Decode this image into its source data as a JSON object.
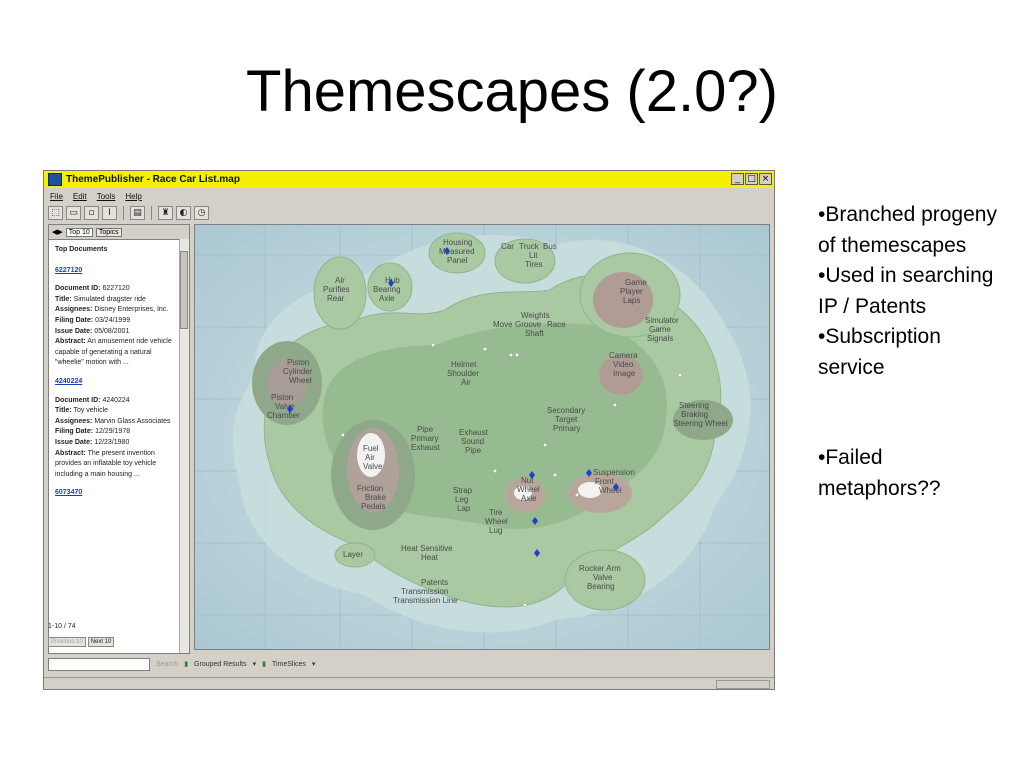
{
  "slide": {
    "title": "Themescapes (2.0?)",
    "bullets": [
      "•Branched progeny of themescapes",
      "•Used in searching IP / Patents",
      "•Subscription service",
      "•Failed metaphors??"
    ]
  },
  "window": {
    "title": "ThemePublisher - Race Car List.map",
    "controls": [
      "_",
      "□",
      "×"
    ],
    "menu": [
      "File",
      "Edit",
      "Tools",
      "Help"
    ]
  },
  "left_panel": {
    "tabs": [
      "Top 10",
      "Topics"
    ],
    "heading": "Top Documents",
    "records": [
      {
        "link": "6227120",
        "doc_id_label": "Document ID:",
        "doc_id": "6227120",
        "title_label": "Title:",
        "title": "Simulated dragster ride",
        "assignees_label": "Assignees:",
        "assignees": "Disney Enterprises, Inc.",
        "filing_label": "Filing Date:",
        "filing": "03/24/1999",
        "issue_label": "Issue Date:",
        "issue": "05/08/2001",
        "abstract_label": "Abstract:",
        "abstract": "An amusement ride vehicle capable of generating a natural \"wheelie\" motion with ..."
      },
      {
        "link": "4240224",
        "doc_id_label": "Document ID:",
        "doc_id": "4240224",
        "title_label": "Title:",
        "title": "Toy vehicle",
        "assignees_label": "Assignees:",
        "assignees": "Marvin Glass Associates",
        "filing_label": "Filing Date:",
        "filing": "12/29/1978",
        "issue_label": "Issue Date:",
        "issue": "12/23/1980",
        "abstract_label": "Abstract:",
        "abstract": "The present invention provides an inflatable toy vehicle including a main housing ..."
      }
    ],
    "next_link": "6073470",
    "count": "1-10 / 74",
    "prev_button": "Previous 10",
    "next_button": "Next 10"
  },
  "bottom_bar": {
    "search_button": "Search",
    "grouped_results": "Grouped Results",
    "timeslices": "TimeSlices"
  },
  "map": {
    "labels": [
      "Housing",
      "Measured",
      "Panel",
      "Car",
      "Truck",
      "Bus",
      "Lit",
      "Tires",
      "Air",
      "Purifies",
      "Rear",
      "Hub",
      "Bearing",
      "Axle",
      "Game",
      "Player",
      "Laps",
      "Weights",
      "Move",
      "Groove",
      "Race",
      "Shaft",
      "Simulator",
      "Game",
      "Signals",
      "Piston",
      "Cylinder",
      "Wheel",
      "Helmet",
      "Shoulder",
      "Air",
      "Camera",
      "Video",
      "Image",
      "Piston",
      "Valve",
      "Chamber",
      "Secondary",
      "Target",
      "Primary",
      "Steering",
      "Braking",
      "Steering Wheel",
      "Fuel",
      "Air",
      "Valve",
      "Pipe",
      "Primary",
      "Exhaust",
      "Exhaust",
      "Sound",
      "Pipe",
      "Friction",
      "Brake",
      "Pedals",
      "Nut",
      "Wheel",
      "Axle",
      "Suspension",
      "Front",
      "Wheel",
      "Strap",
      "Leg",
      "Lap",
      "Tire",
      "Wheel",
      "Lug",
      "Layer",
      "Heat Sensitive",
      "Heat",
      "Patents",
      "Transmission",
      "Transmission Line",
      "Rocker Arm",
      "Valve",
      "Bearing"
    ]
  },
  "colors": {
    "titlebar": "#f4f000",
    "water": "#b9d3dc",
    "land": "#9fc19a",
    "link": "#1a3fb5"
  }
}
